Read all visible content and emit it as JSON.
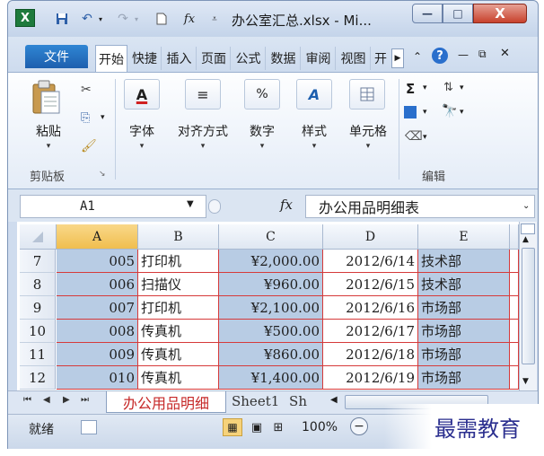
{
  "window": {
    "title": "办公室汇总.xlsx - Mi...",
    "app_icon": "excel-logo",
    "min_glyph": "—",
    "max_glyph": "□",
    "close_glyph": "X"
  },
  "qat": {
    "save_icon": "save-icon",
    "undo_icon": "undo-icon",
    "redo_icon": "redo-icon",
    "new_icon": "new-file-icon",
    "fx_glyph": "fx"
  },
  "tabs": {
    "file": "文件",
    "items": [
      "开始",
      "快捷",
      "插入",
      "页面",
      "公式",
      "数据",
      "审阅",
      "视图",
      "开"
    ],
    "more_glyph": "▶"
  },
  "ribbon": {
    "paste": "粘贴",
    "font": "字体",
    "align": "对齐方式",
    "number": "数字",
    "styles": "样式",
    "cells": "单元格",
    "clipboard_group": "剪贴板",
    "edit_group": "编辑",
    "sum_glyph": "Σ",
    "percent_glyph": "%"
  },
  "formula_bar": {
    "name_box": "A1",
    "fx": "fx",
    "formula": "办公用品明细表"
  },
  "grid": {
    "columns": [
      "A",
      "B",
      "C",
      "D",
      "E"
    ],
    "rows": [
      {
        "num": "7",
        "a": "005",
        "b": "打印机",
        "c": "¥2,000.00",
        "d": "2012/6/14",
        "e": "技术部"
      },
      {
        "num": "8",
        "a": "006",
        "b": "扫描仪",
        "c": "¥960.00",
        "d": "2012/6/15",
        "e": "技术部"
      },
      {
        "num": "9",
        "a": "007",
        "b": "打印机",
        "c": "¥2,100.00",
        "d": "2012/6/16",
        "e": "市场部"
      },
      {
        "num": "10",
        "a": "008",
        "b": "传真机",
        "c": "¥500.00",
        "d": "2012/6/17",
        "e": "市场部"
      },
      {
        "num": "11",
        "a": "009",
        "b": "传真机",
        "c": "¥860.00",
        "d": "2012/6/18",
        "e": "市场部"
      },
      {
        "num": "12",
        "a": "010",
        "b": "传真机",
        "c": "¥1,400.00",
        "d": "2012/6/19",
        "e": "市场部"
      }
    ]
  },
  "sheets": {
    "active": "办公用品明细",
    "second": "Sheet1",
    "third": "Sh"
  },
  "status": {
    "ready": "就绪",
    "zoom": "100%"
  },
  "watermark": "最需教育"
}
